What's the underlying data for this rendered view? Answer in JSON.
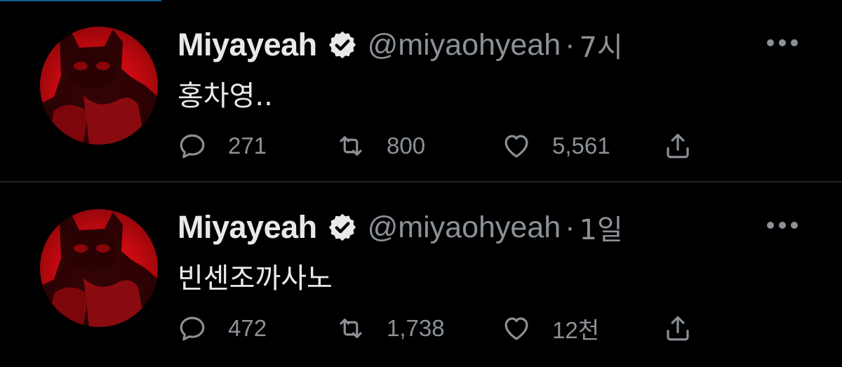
{
  "tweets": [
    {
      "author": {
        "display_name": "Miyayeah",
        "handle": "@miyaohyeah",
        "verified": true,
        "avatar_icon": "avatar-red-cat-mask"
      },
      "separator": "·",
      "time": "7시",
      "text": "홍차영..",
      "actions": {
        "reply": {
          "icon": "reply-icon",
          "count": "271"
        },
        "retweet": {
          "icon": "retweet-icon",
          "count": "800"
        },
        "like": {
          "icon": "heart-icon",
          "count": "5,561"
        },
        "share": {
          "icon": "share-icon"
        }
      }
    },
    {
      "author": {
        "display_name": "Miyayeah",
        "handle": "@miyaohyeah",
        "verified": true,
        "avatar_icon": "avatar-red-cat-mask"
      },
      "separator": "·",
      "time": "1일",
      "text": "빈센조까사노",
      "actions": {
        "reply": {
          "icon": "reply-icon",
          "count": "472"
        },
        "retweet": {
          "icon": "retweet-icon",
          "count": "1,738"
        },
        "like": {
          "icon": "heart-icon",
          "count": "12천"
        },
        "share": {
          "icon": "share-icon"
        }
      }
    }
  ],
  "colors": {
    "background": "#000000",
    "primary_text": "#e7e9ea",
    "secondary_text": "#8b9197",
    "divider": "#202327",
    "avatar_red": "#d10d12"
  }
}
